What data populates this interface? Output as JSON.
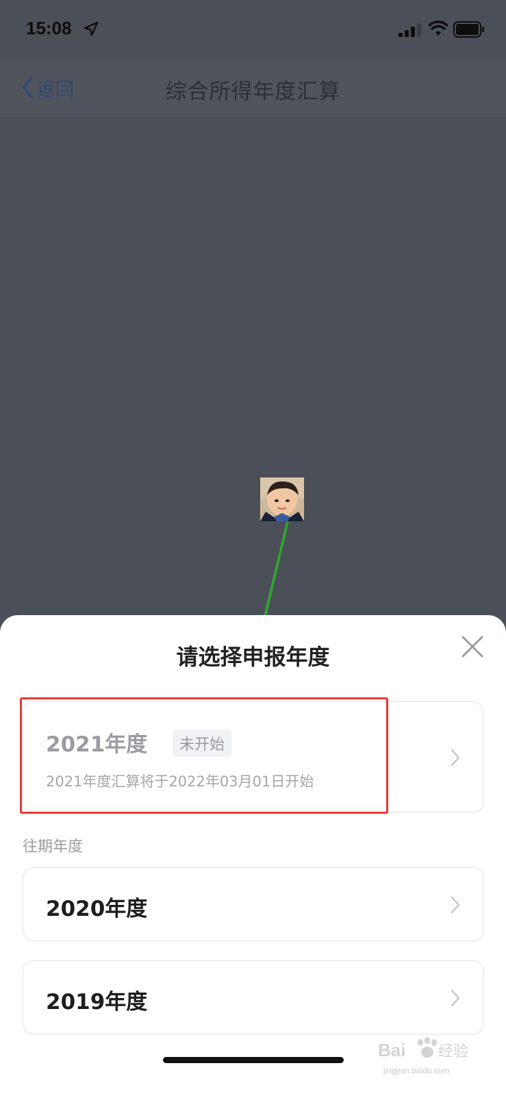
{
  "status_bar": {
    "time": "15:08",
    "icons": [
      "location-arrow-icon",
      "signal-icon",
      "wifi-icon",
      "battery-icon"
    ]
  },
  "nav": {
    "back_label": "返回",
    "title": "综合所得年度汇算"
  },
  "sheet": {
    "title": "请选择申报年度",
    "current_year": {
      "label": "2021年度",
      "badge": "未开始",
      "subtitle": "2021年度汇算将于2022年03月01日开始"
    },
    "past_section_label": "往期年度",
    "past_years": [
      {
        "label": "2020年度"
      },
      {
        "label": "2019年度"
      }
    ]
  },
  "watermark": {
    "brand": "Bai du 经验",
    "url": "jingyan.baidu.com"
  },
  "colors": {
    "overlay": "#4b4f58",
    "highlight": "#e53935",
    "arrow": "#2eaa2a"
  }
}
